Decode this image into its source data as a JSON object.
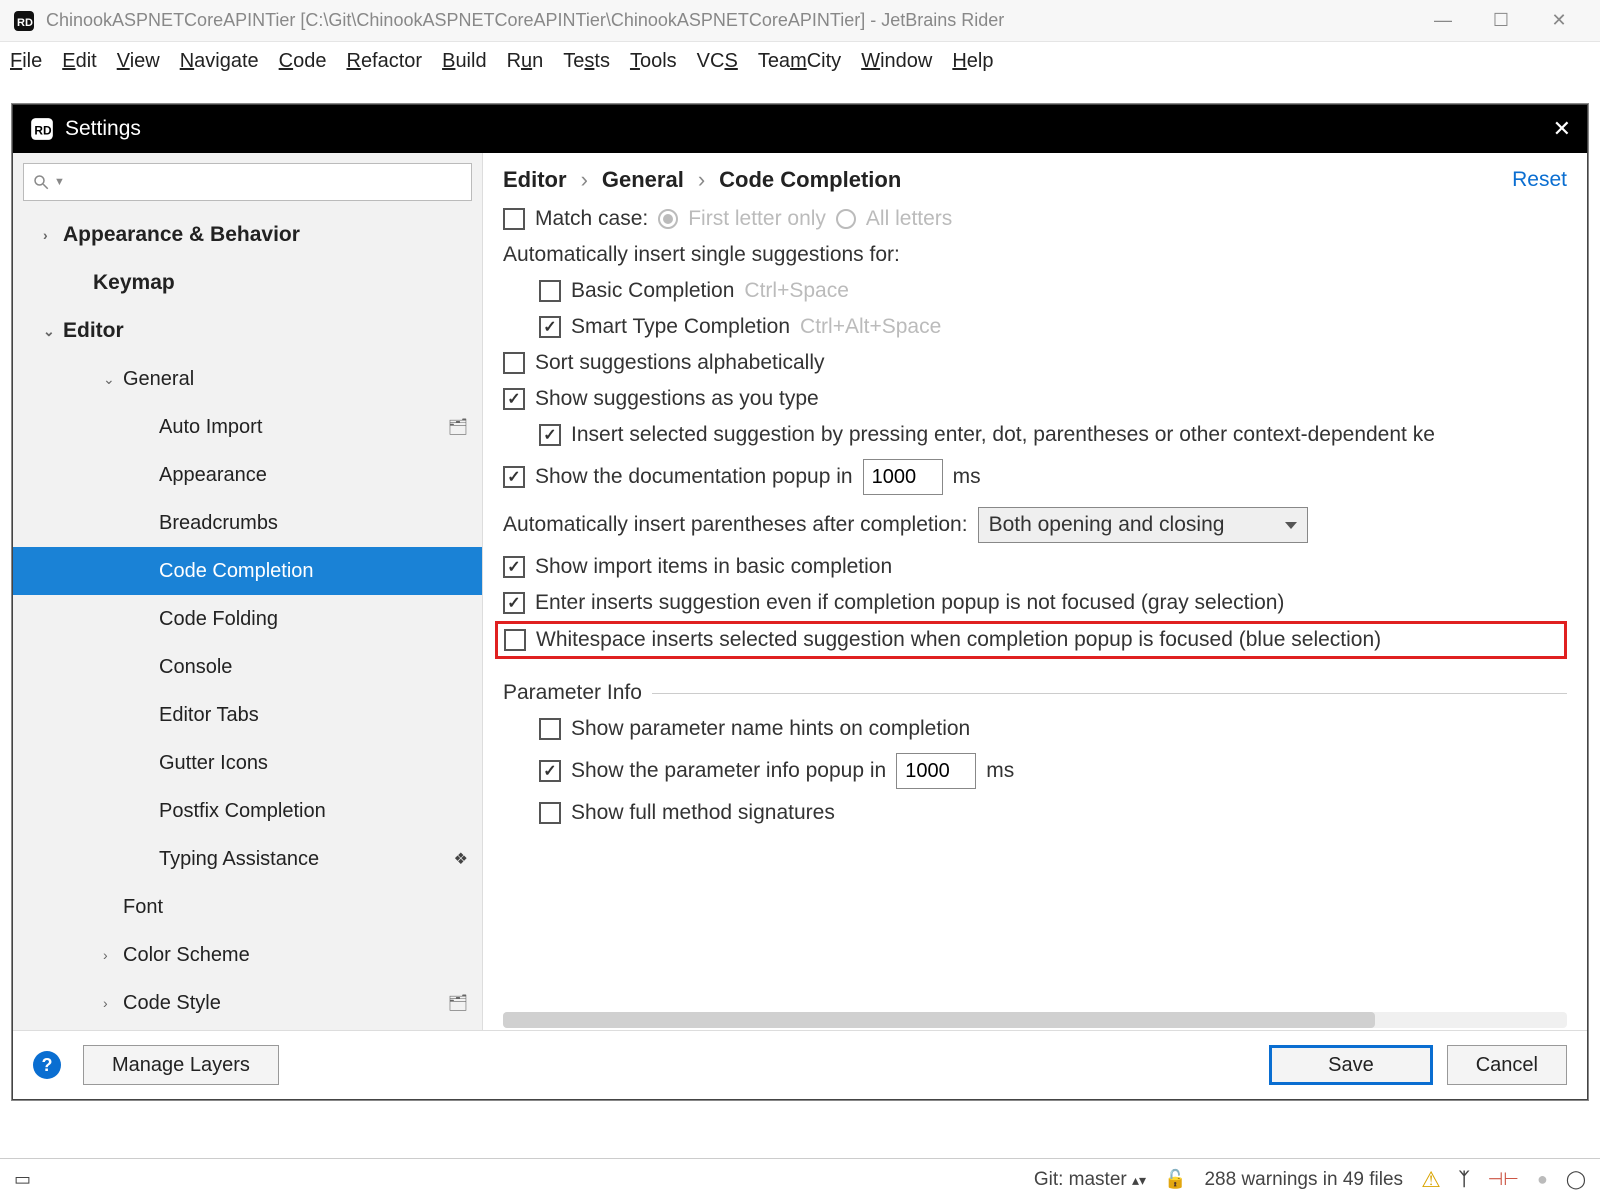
{
  "titlebar": {
    "text": "ChinookASPNETCoreAPINTier [C:\\Git\\ChinookASPNETCoreAPINTier\\ChinookASPNETCoreAPINTier] - JetBrains Rider"
  },
  "menubar": [
    "File",
    "Edit",
    "View",
    "Navigate",
    "Code",
    "Refactor",
    "Build",
    "Run",
    "Tests",
    "Tools",
    "VCS",
    "TeamCity",
    "Window",
    "Help"
  ],
  "modal": {
    "title": "Settings",
    "breadcrumb": [
      "Editor",
      "General",
      "Code Completion"
    ],
    "reset": "Reset",
    "sidebar": {
      "search_placeholder": "",
      "items": [
        {
          "label": "Appearance & Behavior",
          "bold": true,
          "arrow": ">",
          "lvl": 0
        },
        {
          "label": "Keymap",
          "bold": true,
          "arrow": "",
          "lvl": 1
        },
        {
          "label": "Editor",
          "bold": true,
          "arrow": "v",
          "lvl": 0
        },
        {
          "label": "General",
          "bold": false,
          "arrow": "v",
          "lvl": 2
        },
        {
          "label": "Auto Import",
          "bold": false,
          "arrow": "",
          "lvl": 3,
          "badge": "⌂"
        },
        {
          "label": "Appearance",
          "bold": false,
          "arrow": "",
          "lvl": 3
        },
        {
          "label": "Breadcrumbs",
          "bold": false,
          "arrow": "",
          "lvl": 3
        },
        {
          "label": "Code Completion",
          "bold": false,
          "arrow": "",
          "lvl": 3,
          "selected": true
        },
        {
          "label": "Code Folding",
          "bold": false,
          "arrow": "",
          "lvl": 3
        },
        {
          "label": "Console",
          "bold": false,
          "arrow": "",
          "lvl": 3
        },
        {
          "label": "Editor Tabs",
          "bold": false,
          "arrow": "",
          "lvl": 3
        },
        {
          "label": "Gutter Icons",
          "bold": false,
          "arrow": "",
          "lvl": 3
        },
        {
          "label": "Postfix Completion",
          "bold": false,
          "arrow": "",
          "lvl": 3
        },
        {
          "label": "Typing Assistance",
          "bold": false,
          "arrow": "",
          "lvl": 3,
          "stack": "◆"
        },
        {
          "label": "Font",
          "bold": false,
          "arrow": "",
          "lvl": 2
        },
        {
          "label": "Color Scheme",
          "bold": false,
          "arrow": ">",
          "lvl": 2
        },
        {
          "label": "Code Style",
          "bold": false,
          "arrow": ">",
          "lvl": 2,
          "badge": "⌂"
        }
      ]
    },
    "options": {
      "match_case": {
        "label": "Match case:",
        "checked": false,
        "r1": "First letter only",
        "r2": "All letters"
      },
      "auto_insert_header": "Automatically insert single suggestions for:",
      "basic": {
        "label": "Basic Completion",
        "hint": "Ctrl+Space",
        "checked": false
      },
      "smart": {
        "label": "Smart Type Completion",
        "hint": "Ctrl+Alt+Space",
        "checked": true
      },
      "sort_alpha": {
        "label": "Sort suggestions alphabetically",
        "checked": false
      },
      "show_as_type": {
        "label": "Show suggestions as you type",
        "checked": true
      },
      "insert_enter": {
        "label": "Insert selected suggestion by pressing enter, dot, parentheses or other context-dependent ke",
        "checked": true
      },
      "doc_popup": {
        "label1": "Show the documentation popup in",
        "value": "1000",
        "label2": "ms",
        "checked": true
      },
      "auto_parens": {
        "label": "Automatically insert parentheses after completion:",
        "value": "Both opening and closing"
      },
      "show_import": {
        "label": "Show import items in basic completion",
        "checked": true
      },
      "enter_inserts": {
        "label": "Enter inserts suggestion even if completion popup is not focused (gray selection)",
        "checked": true
      },
      "whitespace": {
        "label": "Whitespace inserts selected suggestion when completion popup is focused (blue selection)",
        "checked": false
      },
      "param_section": "Parameter Info",
      "param_hints": {
        "label": "Show parameter name hints on completion",
        "checked": false
      },
      "param_popup": {
        "label1": "Show the parameter info popup in",
        "value": "1000",
        "label2": "ms",
        "checked": true
      },
      "full_sig": {
        "label": "Show full method signatures",
        "checked": false
      }
    },
    "footer": {
      "manage": "Manage Layers",
      "save": "Save",
      "cancel": "Cancel"
    }
  },
  "statusbar": {
    "git": "Git: master",
    "warnings": "288 warnings in 49 files"
  }
}
